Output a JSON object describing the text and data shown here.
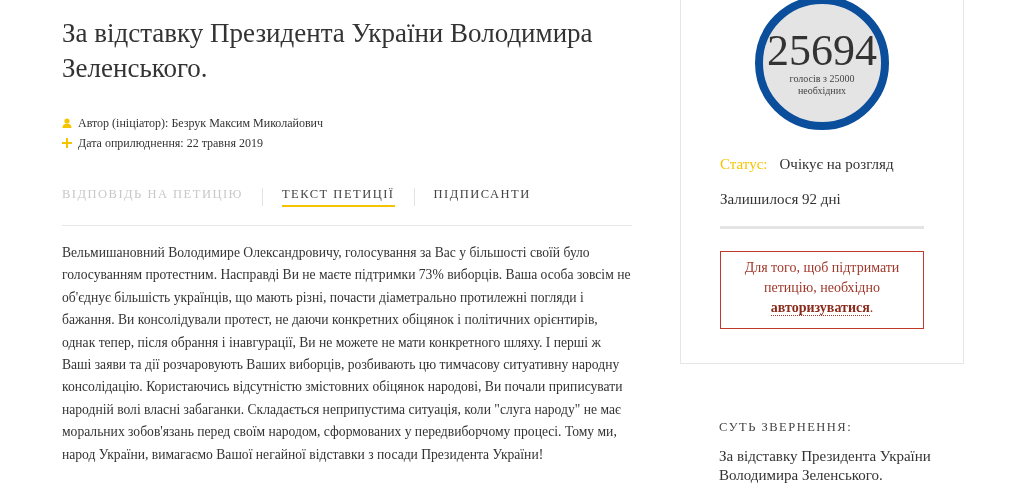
{
  "petition": {
    "title": "За відставку Президента України Володимира Зеленського.",
    "meta": [
      {
        "kind": "author",
        "text": "Автор (ініціатор): Безрук Максим Миколайович"
      },
      {
        "kind": "date",
        "text": "Дата оприлюднення: 22 травня 2019"
      }
    ],
    "tabs": [
      {
        "label": "ВІДПОВІДЬ НА ПЕТИЦІЮ",
        "selected": false,
        "disabled": true
      },
      {
        "label": "ТЕКСТ ПЕТИЦІЇ",
        "selected": true,
        "disabled": false
      },
      {
        "label": "ПІДПИСАНТИ",
        "selected": false,
        "disabled": false
      }
    ],
    "body": "Вельмишановний Володимире Олександровичу, голосування за Вас у більшості своїй було голосуванням протестним. Насправді Ви не маєте підтримки 73% виборців. Ваша особа зовсім не об'єднує більшість українців, що мають різні, почасти діаметрально протилежні погляди і бажання. Ви консолідували протест, не даючи конкретних обіцянок і політичних орієнтирів, однак тепер, після обрання і інавгурації, Ви не можете не мати конкретного шляху. І перші ж Ваші заяви та дії розчаровують Ваших виборців, розбивають цю тимчасову ситуативну народну консолідацію. Користаючись відсутністю змістовних обіцянок народові, Ви почали приписувати народній волі власні забаганки. Складається неприпустима ситуація, коли \"слуга народу\" не має моральних зобов'язань перед своїм народом, сформованих у передвиборчому процесі. Тому ми, народ України, вимагаємо Вашої негайної відставки з посади Президента України!"
  },
  "sidebar": {
    "votes": "25694",
    "votes_caption": "голосів з 25000 необхідних",
    "status_label": "Статус:",
    "status_value": "Очікує на розгляд",
    "remaining": "Залишилося 92 дні",
    "auth_notice": {
      "before": "Для того, щоб підтримати петицію, необхідно",
      "link": "авторизуватися",
      "after": "."
    },
    "summary_heading": "СУТЬ ЗВЕРНЕННЯ:",
    "summary_text": "За відставку Президента України Володимира Зеленського."
  }
}
